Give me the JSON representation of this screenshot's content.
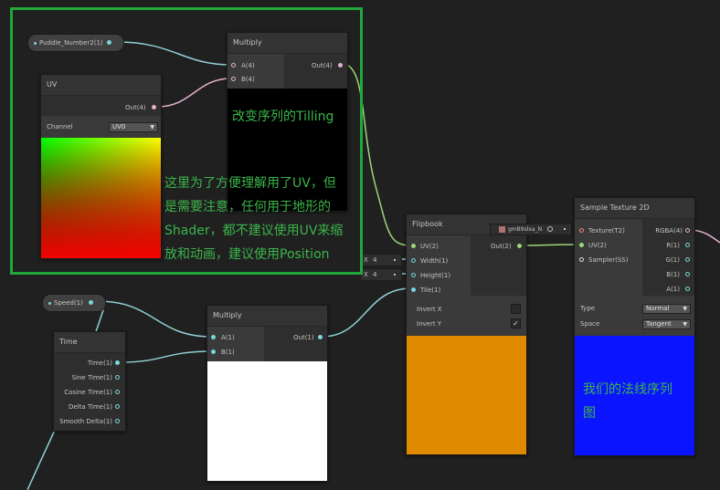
{
  "properties": {
    "puddle": {
      "label": "Puddle_Number2(1)"
    },
    "speed": {
      "label": "Speed(1)"
    }
  },
  "uv_node": {
    "title": "UV",
    "out_label": "Out(4)",
    "channel_label": "Channel",
    "channel_value": "UV0"
  },
  "multiply_top": {
    "title": "Multiply",
    "in_a": "A(4)",
    "in_b": "B(4)",
    "out": "Out(4)"
  },
  "multiply_bottom": {
    "title": "Multiply",
    "in_a": "A(1)",
    "in_b": "B(1)",
    "out": "Out(1)"
  },
  "time_node": {
    "title": "Time",
    "outputs": [
      "Time(1)",
      "Sine Time(1)",
      "Cosine Time(1)",
      "Delta Time(1)",
      "Smooth Delta(1)"
    ]
  },
  "flipbook": {
    "title": "Flipbook",
    "in_uv": "UV(2)",
    "in_width": "Width(1)",
    "in_height": "Height(1)",
    "in_tile": "Tile(1)",
    "out": "Out(2)",
    "width_axis": "X",
    "width_value": "4",
    "height_axis": "X",
    "height_value": "4",
    "invert_x": "Invert X",
    "invert_y": "Invert Y",
    "invert_y_check": "✓",
    "preview_color": "#e08a00"
  },
  "texture_field": {
    "value": "gmB9slxa_N"
  },
  "sample_texture": {
    "title": "Sample Texture 2D",
    "in_texture": "Texture(T2)",
    "in_uv": "UV(2)",
    "in_sampler": "Sampler(SS)",
    "out_rgba": "RGBA(4)",
    "out_r": "R(1)",
    "out_g": "G(1)",
    "out_b": "B(1)",
    "out_a": "A(1)",
    "type_label": "Type",
    "type_value": "Normal",
    "space_label": "Space",
    "space_value": "Tangent",
    "preview_color": "#0a14ff"
  },
  "annotations": {
    "tilling": "改变序列的Tilling",
    "uv_note_1": "这里为了方便理解用了UV，但",
    "uv_note_2": "是需要注意，任何用于地形的",
    "uv_note_3": "Shader，都不建议使用UV来缩",
    "uv_note_4": "放和动画，建议使用Position",
    "normal_note_1": "我们的法线序列",
    "normal_note_2": "图"
  },
  "colors": {
    "highlight_box": "#21a83a",
    "annotation_text": "#3bb54a",
    "wire_vector": "#8fd0d6",
    "wire_uv": "#9cd67a",
    "wire_vec4": "#e4b0ce"
  }
}
